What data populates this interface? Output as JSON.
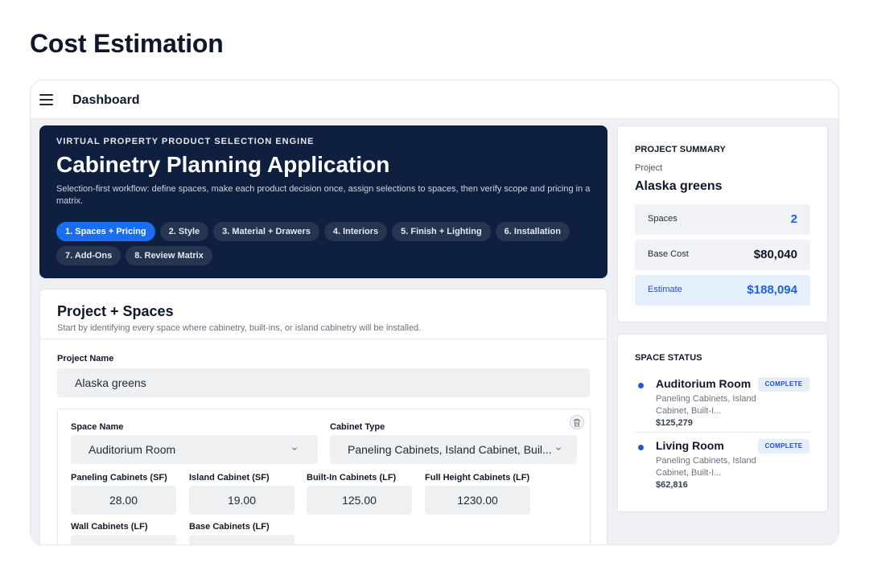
{
  "page_title": "Cost Estimation",
  "topbar": {
    "title": "Dashboard"
  },
  "hero": {
    "eyebrow": "VIRTUAL PROPERTY PRODUCT SELECTION ENGINE",
    "title": "Cabinetry Planning Application",
    "description": "Selection-first workflow: define spaces, make each product decision once, assign selections to spaces, then verify scope and pricing in a matrix.",
    "steps": [
      "1. Spaces + Pricing",
      "2. Style",
      "3. Material + Drawers",
      "4. Interiors",
      "5. Finish + Lighting",
      "6. Installation",
      "7. Add-Ons",
      "8. Review Matrix"
    ],
    "active_step": 0
  },
  "project": {
    "title": "Project + Spaces",
    "subtitle": "Start by identifying every space where cabinetry, built-ins, or island cabinetry will be installed.",
    "name_label": "Project Name",
    "name_value": "Alaska greens",
    "space": {
      "space_name_label": "Space Name",
      "space_name_value": "Auditorium Room",
      "cabinet_type_label": "Cabinet Type",
      "cabinet_type_value": "Paneling Cabinets, Island Cabinet, Buil...",
      "measures": [
        {
          "label": "Paneling Cabinets (SF)",
          "value": "28.00"
        },
        {
          "label": "Island Cabinet (SF)",
          "value": "19.00"
        },
        {
          "label": "Built-In Cabinets (LF)",
          "value": "125.00"
        },
        {
          "label": "Full Height Cabinets (LF)",
          "value": "1230.00"
        },
        {
          "label": "Wall Cabinets (LF)",
          "value": ""
        },
        {
          "label": "Base Cabinets (LF)",
          "value": ""
        }
      ]
    }
  },
  "summary": {
    "heading": "PROJECT SUMMARY",
    "project_label": "Project",
    "project_name": "Alaska greens",
    "spaces_label": "Spaces",
    "spaces_value": "2",
    "base_cost_label": "Base Cost",
    "base_cost_value": "$80,040",
    "estimate_label": "Estimate",
    "estimate_value": "$188,094"
  },
  "status": {
    "heading": "SPACE STATUS",
    "items": [
      {
        "name": "Auditorium Room",
        "desc": "Paneling Cabinets, Island Cabinet, Built-I...",
        "cost": "$125,279",
        "badge": "COMPLETE"
      },
      {
        "name": "Living Room",
        "desc": "Paneling Cabinets, Island Cabinet, Built-I...",
        "cost": "$62,816",
        "badge": "COMPLETE"
      }
    ]
  },
  "colors": {
    "hero_bg": "#0f1f40",
    "accent": "#1a6cf0",
    "estimate_text": "#1d63d8"
  }
}
